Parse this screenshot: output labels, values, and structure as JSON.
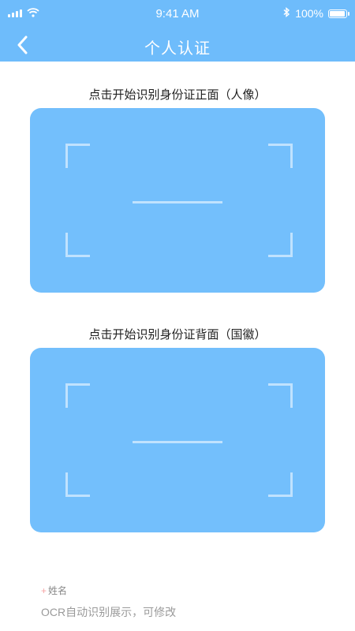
{
  "status_bar": {
    "time": "9:41 AM",
    "battery_percent": "100%",
    "icons": [
      "signal-icon",
      "wifi-icon",
      "bluetooth-icon",
      "battery-icon"
    ]
  },
  "nav": {
    "title": "个人认证",
    "back_icon": "chevron-left-icon"
  },
  "front_card": {
    "title": "点击开始识别身份证正面（人像）"
  },
  "back_card": {
    "title": "点击开始识别身份证背面（国徽）"
  },
  "name_field": {
    "required_mark": "+",
    "label": "姓名",
    "placeholder": "OCR自动识别展示，可修改"
  },
  "colors": {
    "primary": "#6ebcfb",
    "card": "#73bffc",
    "required": "#f6a3a3"
  }
}
